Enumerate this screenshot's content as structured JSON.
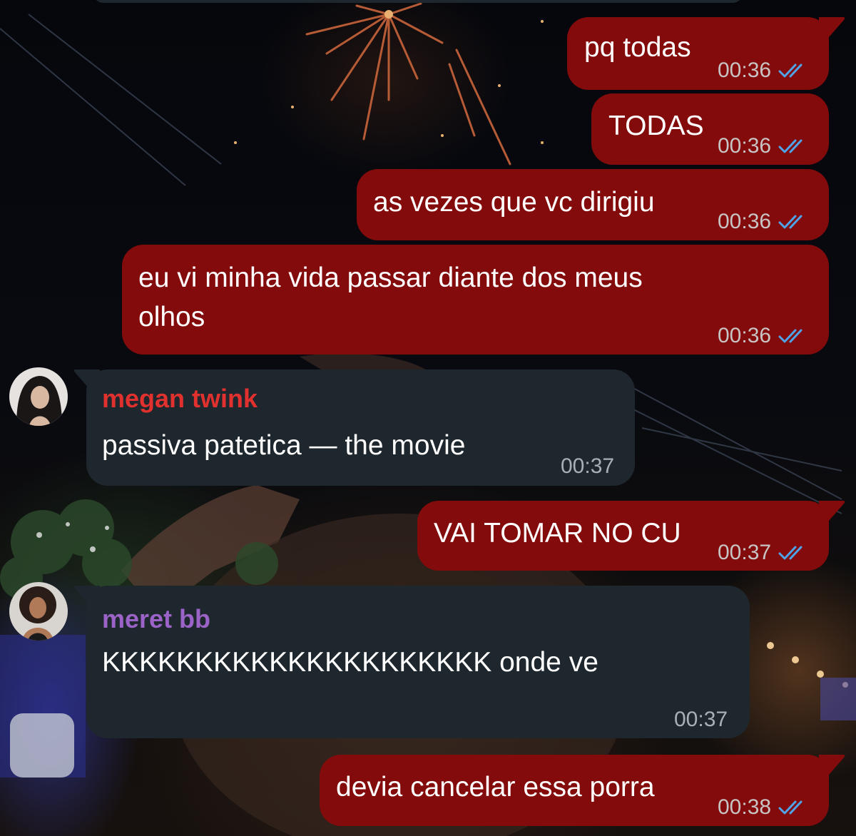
{
  "colors": {
    "outgoing_bubble": "#830b0b",
    "incoming_bubble": "#1e272d",
    "read_ticks": "#4fa3e8",
    "sender_megan": "#e0312f",
    "sender_meret": "#9b63c7"
  },
  "messages": [
    {
      "direction": "outgoing",
      "text": "pq todas",
      "time": "00:36",
      "status_icon": "double-check-icon"
    },
    {
      "direction": "outgoing",
      "text": "TODAS",
      "time": "00:36",
      "status_icon": "double-check-icon"
    },
    {
      "direction": "outgoing",
      "text": "as vezes que vc dirigiu",
      "time": "00:36",
      "status_icon": "double-check-icon"
    },
    {
      "direction": "outgoing",
      "text_lines": [
        "eu vi minha vida passar diante dos meus",
        "olhos"
      ],
      "time": "00:36",
      "status_icon": "double-check-icon"
    },
    {
      "direction": "incoming",
      "sender": "megan twink",
      "text": "passiva patetica — the movie",
      "time": "00:37",
      "avatar_icon": "avatar-photo"
    },
    {
      "direction": "outgoing",
      "text": "VAI TOMAR NO CU",
      "time": "00:37",
      "status_icon": "double-check-icon"
    },
    {
      "direction": "incoming",
      "sender": "meret bb",
      "text": "KKKKKKKKKKKKKKKKKKKKK onde ve",
      "time": "00:37",
      "avatar_icon": "avatar-photo"
    },
    {
      "direction": "outgoing",
      "text": "devia cancelar essa porra",
      "time": "00:38",
      "status_icon": "double-check-icon"
    }
  ]
}
